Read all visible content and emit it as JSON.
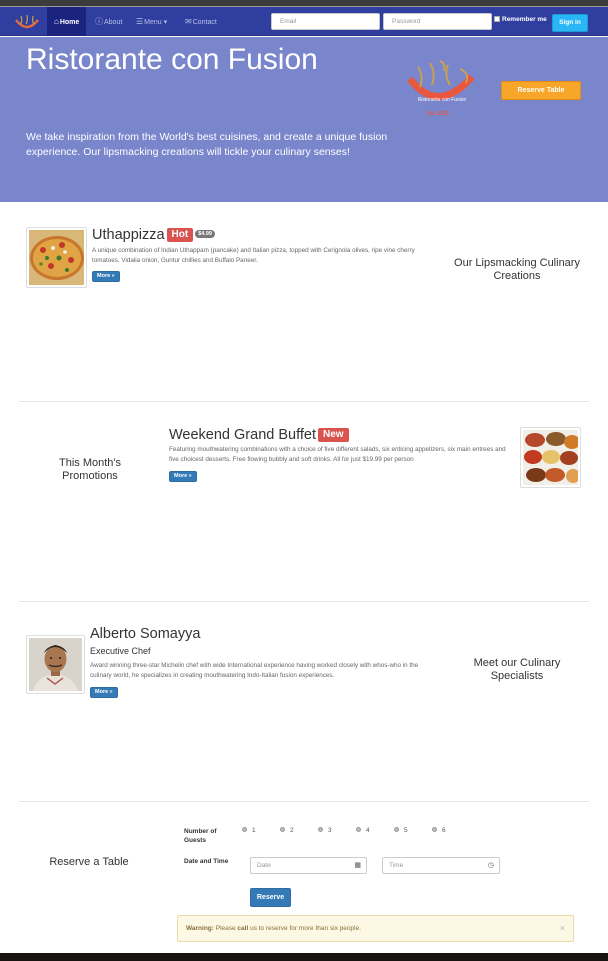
{
  "navbar": {
    "items": [
      {
        "label": "Home",
        "icon": "home-icon"
      },
      {
        "label": "About",
        "icon": "info-icon"
      },
      {
        "label": "Menu",
        "icon": "list-icon"
      },
      {
        "label": "Contact",
        "icon": "envelope-icon"
      }
    ],
    "email_placeholder": "Email",
    "password_placeholder": "Password",
    "remember_label": "Remember me",
    "signin_label": "Sign in"
  },
  "jumbotron": {
    "title": "Ristorante con Fusion",
    "description": "We take inspiration from the World's best cuisines, and create a unique fusion experience. Our lipsmacking creations will tickle your culinary senses!",
    "logo_text": "Ristorante con Fusion",
    "logo_est": "Est. 2013",
    "reserve_button": "Reserve Table"
  },
  "dish": {
    "name": "Uthappizza",
    "badge": "Hot",
    "price": "$4.99",
    "description": "A unique combination of Indian Uthappam (pancake) and Italian pizza, topped with Cerignola olives, ripe vine cherry tomatoes, Vidalia onion, Guntur chillies and Buffalo Paneer.",
    "more_button": "More »",
    "side_heading": "Our Lipsmacking Culinary Creations"
  },
  "promotion": {
    "name": "Weekend Grand Buffet",
    "badge": "New",
    "description": "Featuring mouthwatering combinations with a choice of five different salads, six enticing appetizers, six main entrees and five choicest desserts. Free flowing bubbly and soft drinks. All for just $19.99 per person",
    "more_button": "More »",
    "side_heading": "This Month's Promotions"
  },
  "leader": {
    "name": "Alberto Somayya",
    "designation": "Executive Chef",
    "description": "Award winning three-star Michelin chef with wide International experience having worked closely with whos-who in the culinary world, he specializes in creating mouthwatering Indo-Italian fusion experiences.",
    "more_button": "More »",
    "side_heading": "Meet our Culinary Specialists"
  },
  "reservation": {
    "heading": "Reserve a Table",
    "guests_label": "Number of Guests",
    "guest_options": [
      "1",
      "2",
      "3",
      "4",
      "5",
      "6"
    ],
    "datetime_label": "Date and Time",
    "date_placeholder": "Date",
    "time_placeholder": "Time",
    "submit_label": "Reserve",
    "alert_strong": "Warning:",
    "alert_pre": "Please",
    "alert_call": "call",
    "alert_post": "us to reserve for more than six people.",
    "alert_close": "×"
  },
  "colors": {
    "navbar": "#303f9f",
    "navbar_active": "#1a237e",
    "jumbotron": "#7986cb",
    "reserve_button": "#f7a62a",
    "signin_button": "#29b6f6",
    "badge": "#d9534f",
    "primary_button": "#337ab7"
  }
}
